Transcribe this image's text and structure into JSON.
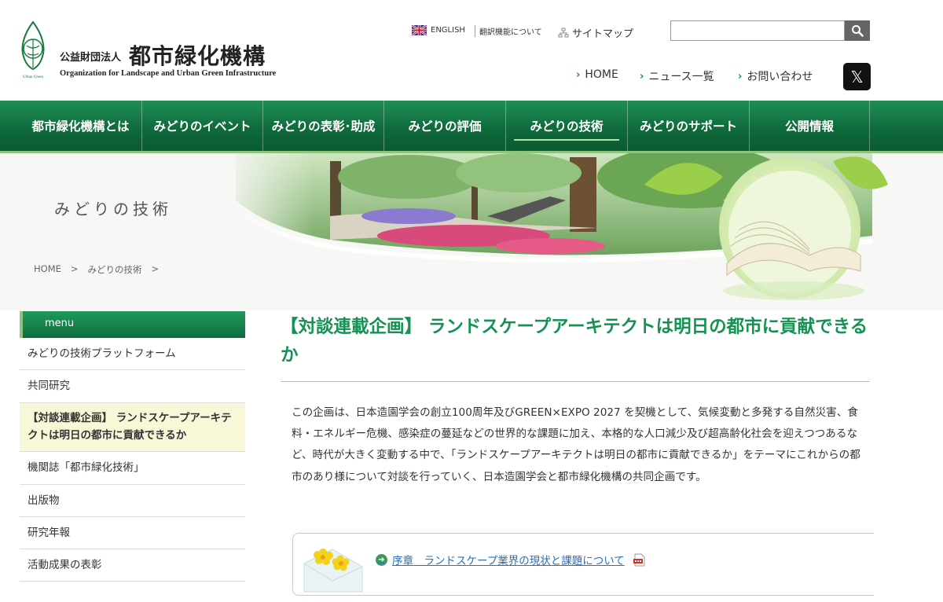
{
  "header": {
    "org_prefix": "公益財団法人",
    "org_name": "都市緑化機構",
    "org_name_en": "Organization for Landscape and Urban Green Infrastructure",
    "logo_label": "Urban Green",
    "lang_link": "ENGLISH",
    "translate_link": "翻訳機能について",
    "sitemap_link": "サイトマップ",
    "search": {
      "value": "",
      "placeholder": ""
    },
    "sub_nav": [
      "HOME",
      "ニュース一覧",
      "お問い合わせ"
    ],
    "x_label": "𝕏"
  },
  "global_nav": [
    "都市緑化機構とは",
    "みどりのイベント",
    "みどりの表彰･助成",
    "みどりの評価",
    "みどりの技術",
    "みどりのサポート",
    "公開情報"
  ],
  "hero": {
    "title": "みどりの技術"
  },
  "breadcrumb": [
    "HOME",
    ">",
    "みどりの技術",
    ">"
  ],
  "sidebar": {
    "header": "menu",
    "items": [
      "みどりの技術プラットフォーム",
      "共同研究",
      "【対談連載企画】 ランドスケープアーキテクトは明日の都市に貢献できるか",
      "機関誌「都市緑化技術」",
      "出版物",
      "研究年報",
      "活動成果の表彰"
    ]
  },
  "main": {
    "title": "【対談連載企画】 ランドスケープアーキテクトは明日の都市に貢献できるか",
    "intro": "この企画は、日本造園学会の創立100周年及びGREEN×EXPO 2027 を契機として、気候変動と多発する自然災害、食料・エネルギー危機、感染症の蔓延などの世界的な課題に加え、本格的な人口減少及び超高齢化社会を迎えつつあるなど、時代が大きく変動する中で、「ランドスケープアーキテクトは明日の都市に貢献できるか」をテーマにこれからの都市のあり様について対談を行っていく、日本造園学会と都市緑化機構の共同企画です。",
    "chapter_link": "序章　ランドスケープ業界の現状と課題について"
  },
  "colors": {
    "brand_green": "#159152",
    "nav_green": "#0f6b3c",
    "accent_light": "#8fc47c",
    "active_bg": "#f8f8d8"
  }
}
